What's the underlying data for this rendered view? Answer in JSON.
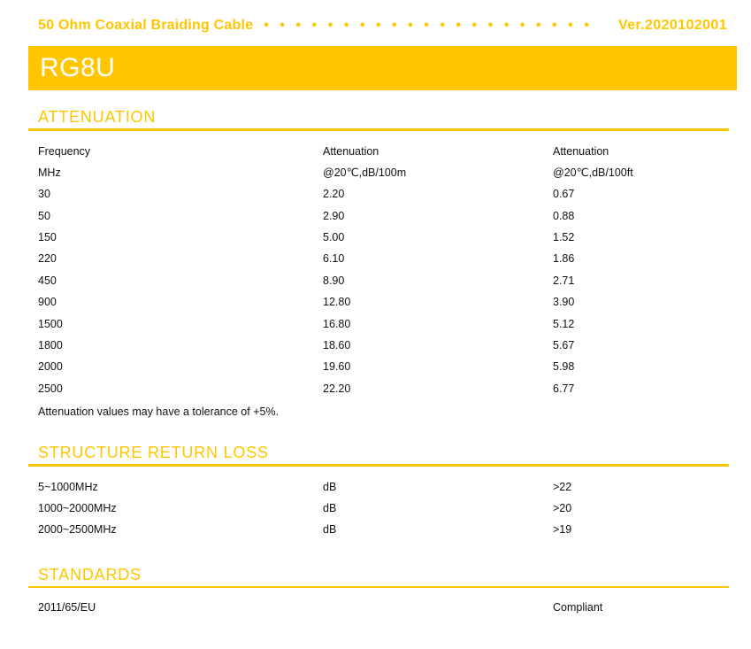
{
  "colors": {
    "accent": "#FFC600",
    "banner_text": "#FFFFFF",
    "body_text": "#111111",
    "page_bg": "#FFFFFF"
  },
  "header": {
    "product_title": "50 Ohm Coaxial Braiding Cable",
    "leader_dots": "•••••••••••••••••••••",
    "version": "Ver.2020102001",
    "model": "RG8U"
  },
  "sections": {
    "attenuation": {
      "heading": "ATTENUATION",
      "columns": {
        "h1": [
          "Frequency",
          "Attenuation",
          "Attenuation"
        ],
        "h2": [
          "MHz",
          "@20℃,dB/100m",
          "@20℃,dB/100ft"
        ]
      },
      "rows": [
        [
          "30",
          "2.20",
          "0.67"
        ],
        [
          "50",
          "2.90",
          "0.88"
        ],
        [
          "150",
          "5.00",
          "1.52"
        ],
        [
          "220",
          "6.10",
          "1.86"
        ],
        [
          "450",
          "8.90",
          "2.71"
        ],
        [
          "900",
          "12.80",
          "3.90"
        ],
        [
          "1500",
          "16.80",
          "5.12"
        ],
        [
          "1800",
          "18.60",
          "5.67"
        ],
        [
          "2000",
          "19.60",
          "5.98"
        ],
        [
          "2500",
          "22.20",
          "6.77"
        ]
      ],
      "note": "Attenuation values may have a tolerance of +5%."
    },
    "structure_return_loss": {
      "heading": "STRUCTURE RETURN LOSS",
      "rows": [
        [
          "5~1000MHz",
          "dB",
          ">22"
        ],
        [
          "1000~2000MHz",
          "dB",
          ">20"
        ],
        [
          "2000~2500MHz",
          "dB",
          ">19"
        ]
      ]
    },
    "standards": {
      "heading": "STANDARDS",
      "rows": [
        [
          "2011/65/EU",
          "",
          "Compliant"
        ]
      ]
    }
  }
}
